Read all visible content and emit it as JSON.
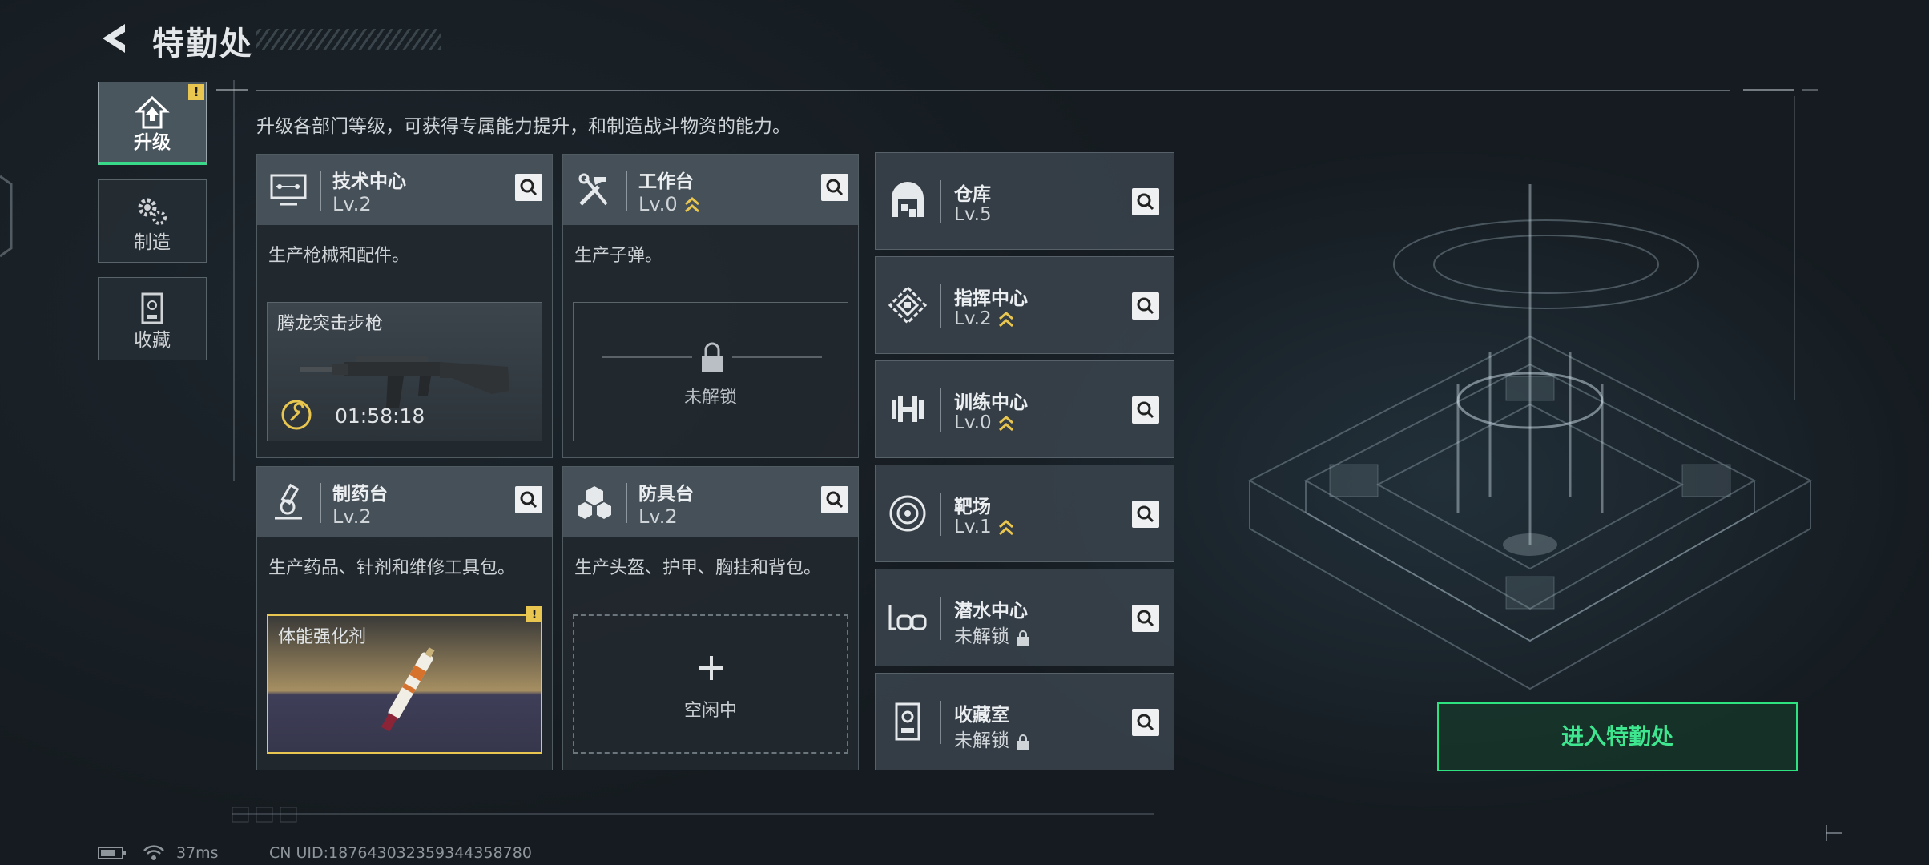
{
  "header": {
    "title": "特勤处"
  },
  "sidebar": {
    "items": [
      {
        "label": "升级",
        "icon": "upgrade-icon",
        "active": true,
        "badge": "!"
      },
      {
        "label": "制造",
        "icon": "gears-icon",
        "active": false
      },
      {
        "label": "收藏",
        "icon": "display-case-icon",
        "active": false
      }
    ]
  },
  "description": "升级各部门等级，可获得专属能力提升，和制造战斗物资的能力。",
  "cards": {
    "tech": {
      "name": "技术中心",
      "level": "Lv.2",
      "desc": "生产枪械和配件。",
      "slot_item": "腾龙突击步枪",
      "timer": "01:58:18"
    },
    "workbench": {
      "name": "工作台",
      "level": "Lv.0",
      "desc": "生产子弹。",
      "slot_status": "未解锁"
    },
    "pharmacy": {
      "name": "制药台",
      "level": "Lv.2",
      "desc": "生产药品、针剂和维修工具包。",
      "slot_item": "体能强化剂",
      "badge": "!"
    },
    "armor": {
      "name": "防具台",
      "level": "Lv.2",
      "desc": "生产头盔、护甲、胸挂和背包。",
      "slot_status": "空闲中"
    }
  },
  "facilities": [
    {
      "name": "仓库",
      "level": "Lv.5",
      "icon": "warehouse-icon"
    },
    {
      "name": "指挥中心",
      "level": "Lv.2",
      "icon": "command-center-icon",
      "upgradable": true
    },
    {
      "name": "训练中心",
      "level": "Lv.0",
      "icon": "dumbbell-icon",
      "upgradable": true
    },
    {
      "name": "靶场",
      "level": "Lv.1",
      "icon": "target-icon",
      "upgradable": true
    },
    {
      "name": "潜水中心",
      "level": "未解锁",
      "icon": "diving-goggles-icon",
      "locked": true
    },
    {
      "name": "收藏室",
      "level": "未解锁",
      "icon": "collection-room-icon",
      "locked": true
    }
  ],
  "enter_button": "进入特勤处",
  "status_bar": {
    "ping": "37ms",
    "uid": "CN UID:187643032359344358780"
  },
  "colors": {
    "accent_green": "#2ee27f",
    "upgrade_gold": "#e8c650",
    "panel": "#4a545c"
  }
}
